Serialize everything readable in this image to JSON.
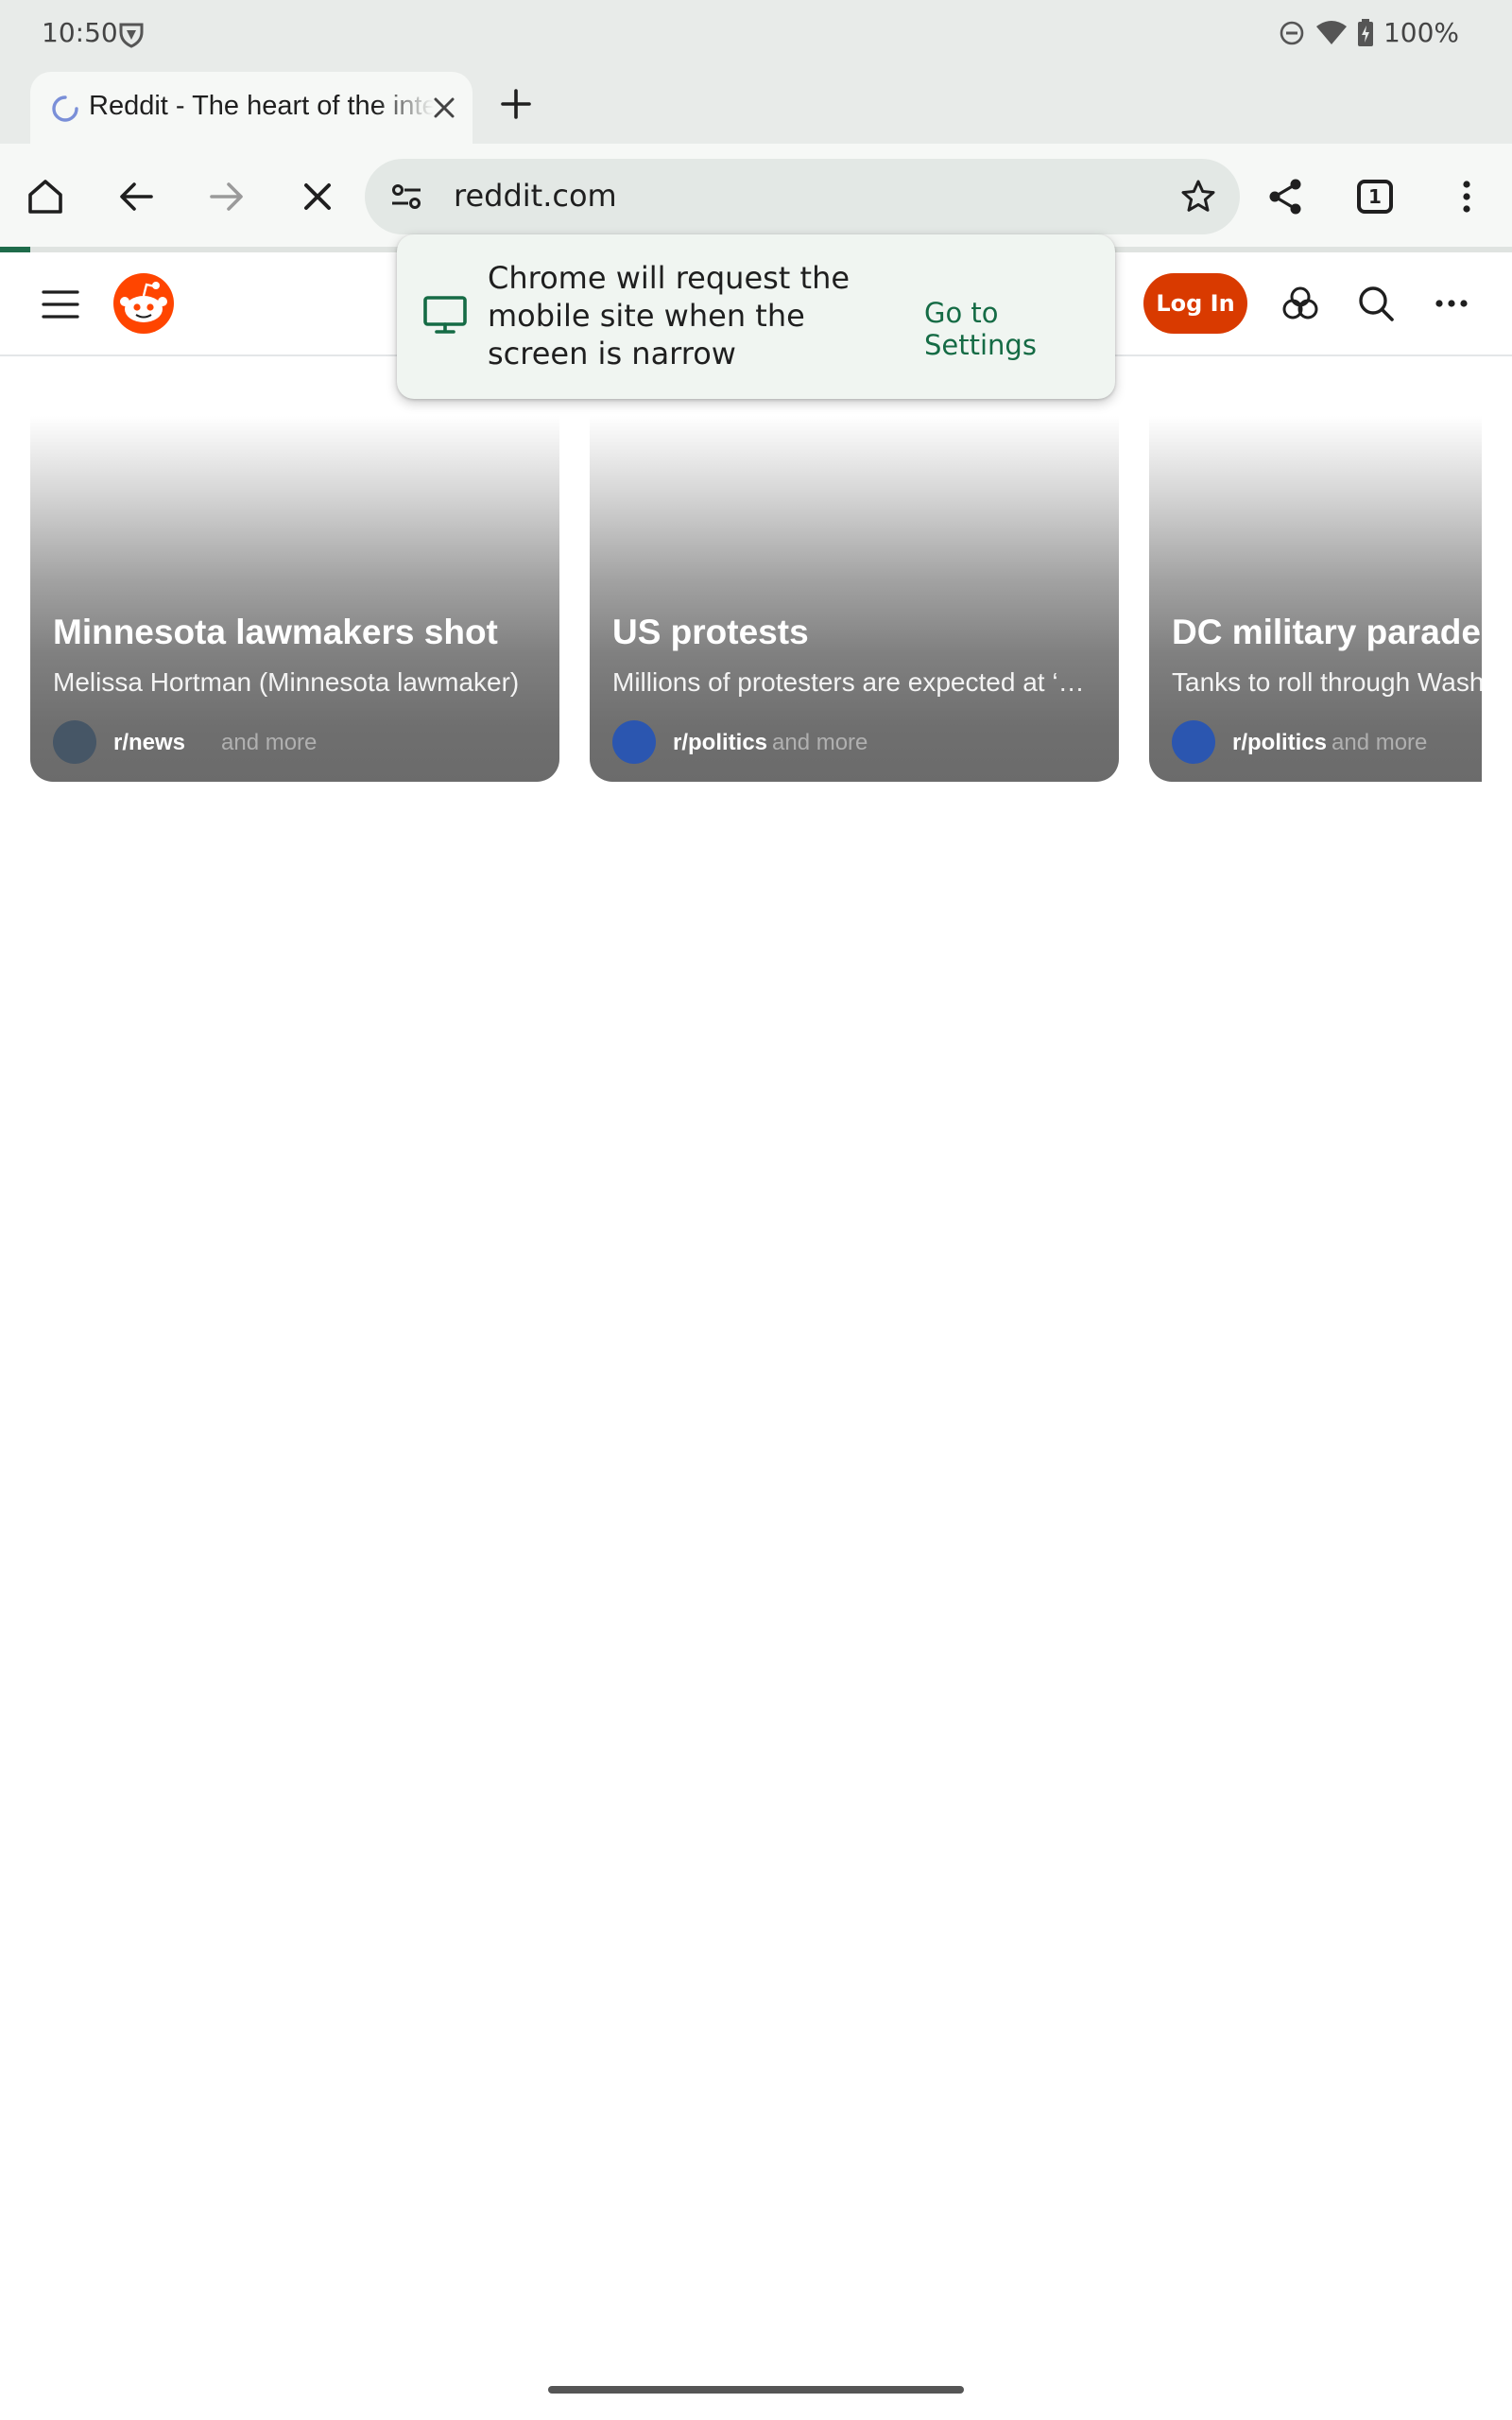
{
  "status_bar": {
    "time": "10:50",
    "battery": "100%",
    "icons": [
      "vpn-key-icon",
      "do-not-disturb-icon",
      "wifi-icon",
      "battery-charging-icon"
    ]
  },
  "browser": {
    "tab": {
      "title": "Reddit - The heart of the internet",
      "icon": "loading-spinner-icon"
    },
    "toolbar": {
      "url": "reddit.com",
      "tab_count": "1",
      "icons": [
        "home-icon",
        "back-arrow-icon",
        "forward-arrow-icon",
        "stop-icon",
        "site-settings-icon",
        "bookmark-star-icon",
        "share-icon",
        "tab-switcher-icon",
        "more-vert-icon"
      ]
    },
    "page_load_progress": 0.02
  },
  "popup": {
    "message": "Chrome will request the mobile site when the screen is narrow",
    "action": "Go to Settings",
    "icon": "desktop-monitor-icon"
  },
  "reddit_header": {
    "login_label": "Log In",
    "icons": [
      "menu-icon",
      "reddit-logo-icon",
      "advertise-icon",
      "search-icon",
      "more-horiz-icon"
    ],
    "colors": {
      "brand": "#d93a00"
    }
  },
  "trending": [
    {
      "title": "Minnesota lawmakers shot",
      "subtitle": "Melissa Hortman (Minnesota lawmaker)",
      "subreddit": "r/news",
      "more": "and more",
      "avatar_color": "#465666"
    },
    {
      "title": "US protests",
      "subtitle": "Millions of protesters are expected at ‘No Kings’ protests",
      "subreddit": "r/politics",
      "more": "and more",
      "avatar_color": "#2b56b0"
    },
    {
      "title": "DC military parade",
      "subtitle": "Tanks to roll through Washington",
      "subreddit": "r/politics",
      "more": "and more",
      "avatar_color": "#2b56b0"
    }
  ]
}
